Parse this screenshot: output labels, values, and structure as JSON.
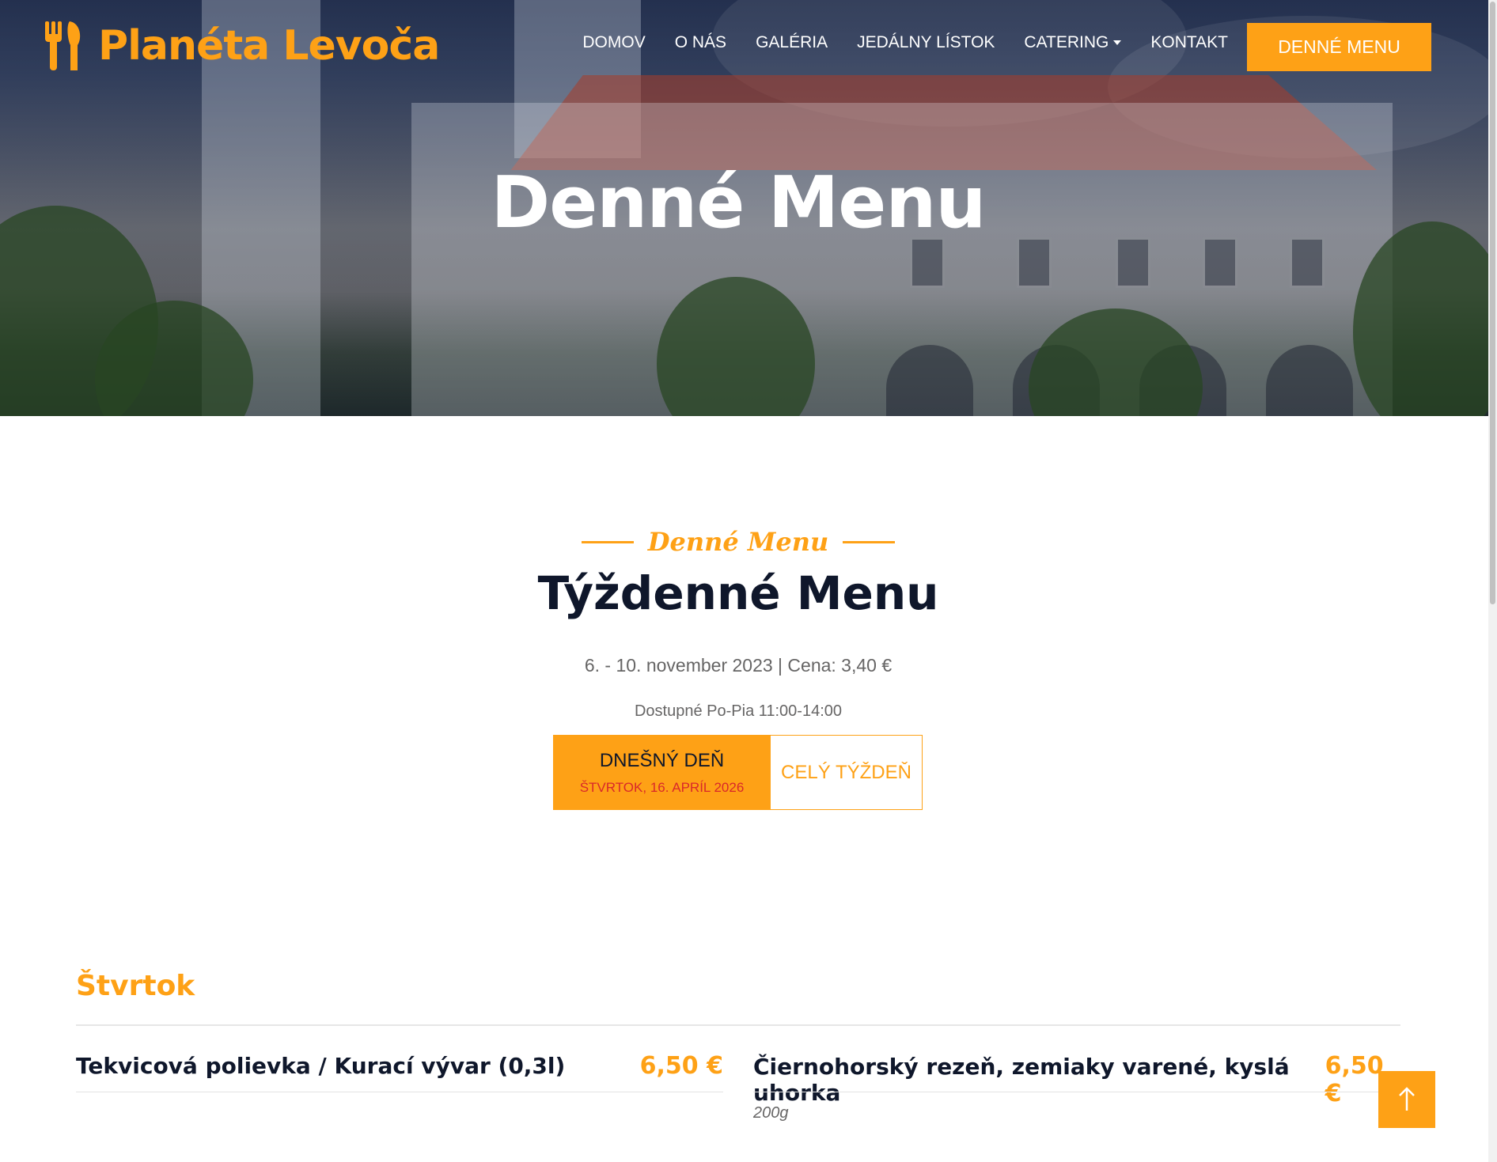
{
  "brand": {
    "name": "Planéta Levoča",
    "icon": "utensils-icon"
  },
  "nav": {
    "items": [
      {
        "label": "DOMOV"
      },
      {
        "label": "O NÁS"
      },
      {
        "label": "GALÉRIA"
      },
      {
        "label": "JEDÁLNY LÍSTOK"
      },
      {
        "label": "CATERING",
        "dropdown": true
      },
      {
        "label": "KONTAKT"
      }
    ],
    "cta": "DENNÉ MENU"
  },
  "hero": {
    "title": "Denné Menu"
  },
  "section": {
    "subtitle": "Denné Menu",
    "title": "Týždenné Menu",
    "date_price": "6. - 10. november 2023 | Cena: 3,40 €",
    "availability": "Dostupné Po-Pia 11:00-14:00"
  },
  "tabs": {
    "today_label": "DNEŠNÝ DEŇ",
    "today_date": "ŠTVRTOK, 16. APRÍL 2026",
    "week_label": "CELÝ TÝŽDEŇ"
  },
  "day": {
    "name": "Štvrtok",
    "items": [
      {
        "name": "Tekvicová polievka / Kurací vývar (0,3l)",
        "price": "6,50 €"
      },
      {
        "name": "Čiernohorský rezeň, zemiaky varené, kyslá uhorka",
        "price": "6,50 €",
        "weight": "200g"
      }
    ]
  },
  "colors": {
    "accent": "#fea116",
    "dark": "#0f172b",
    "muted": "#666565",
    "date_red": "#d9282a"
  }
}
